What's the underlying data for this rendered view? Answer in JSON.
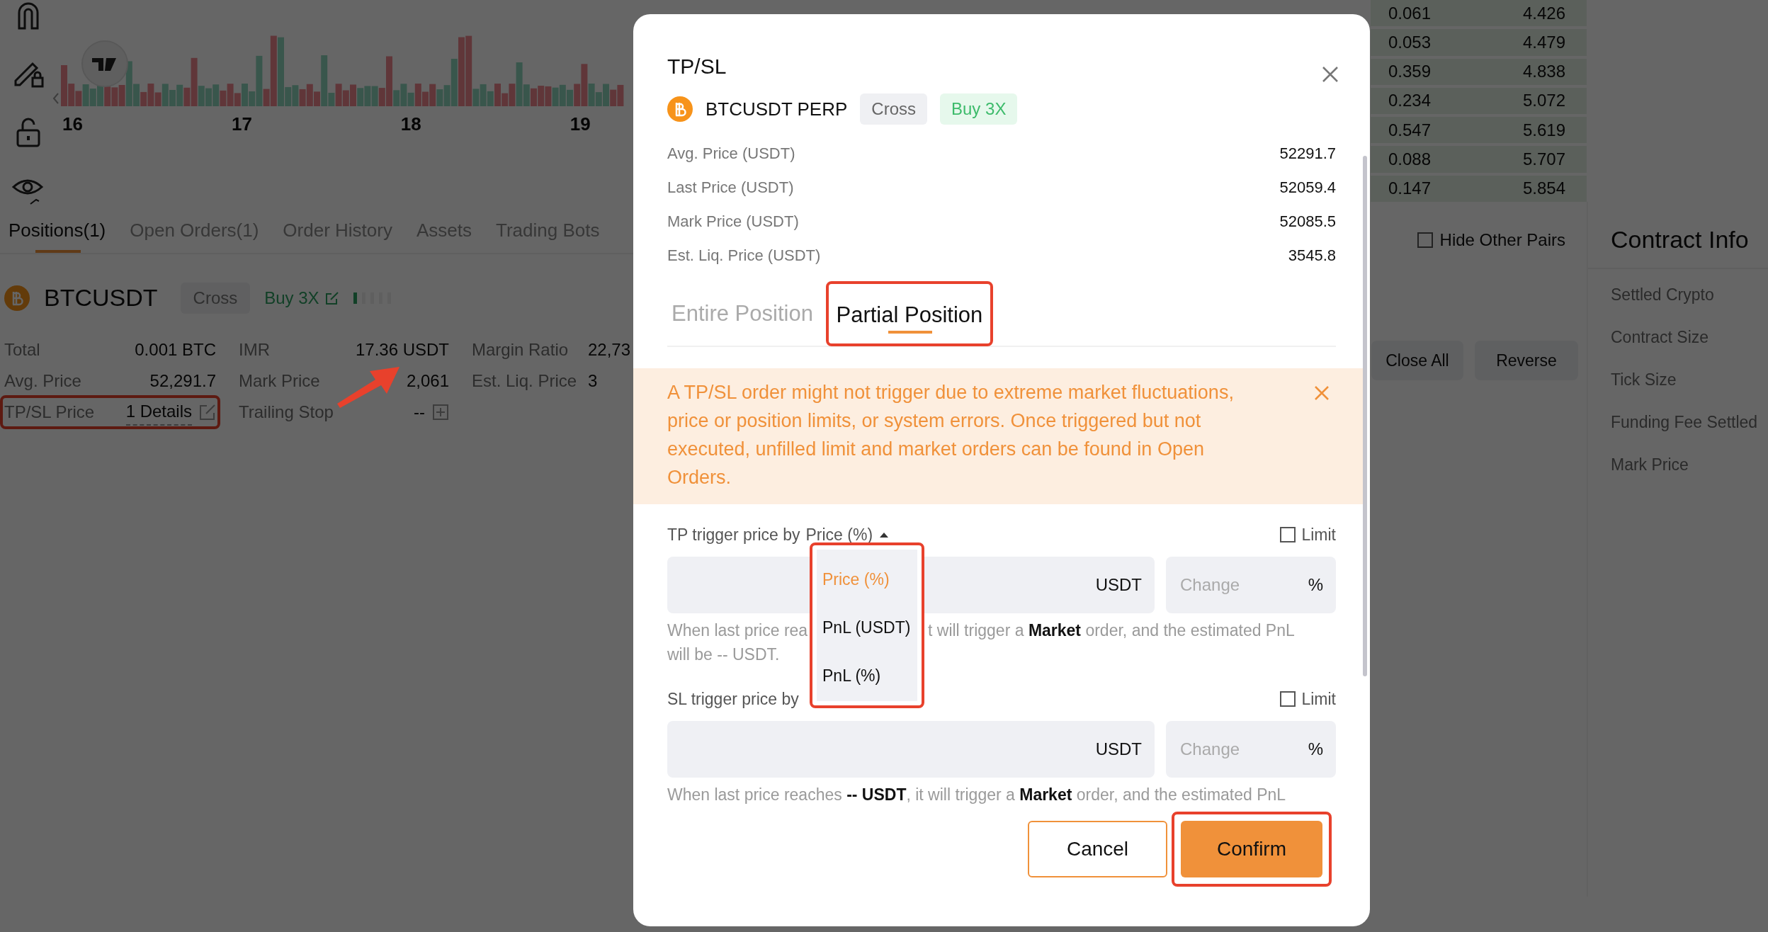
{
  "chart": {
    "date_labels": [
      "16",
      "17",
      "18",
      "19"
    ]
  },
  "order_book": {
    "rows": [
      {
        "amount": "0.061",
        "total": "4.426"
      },
      {
        "amount": "0.053",
        "total": "4.479"
      },
      {
        "amount": "0.359",
        "total": "4.838"
      },
      {
        "amount": "0.234",
        "total": "5.072"
      },
      {
        "amount": "0.547",
        "total": "5.619"
      },
      {
        "amount": "0.088",
        "total": "5.707"
      },
      {
        "amount": "0.147",
        "total": "5.854"
      }
    ]
  },
  "position_tabs": [
    {
      "label": "Positions(1)",
      "selected": true
    },
    {
      "label": "Open Orders(1)",
      "selected": false
    },
    {
      "label": "Order History",
      "selected": false
    },
    {
      "label": "Assets",
      "selected": false
    },
    {
      "label": "Trading Bots",
      "selected": false
    }
  ],
  "hide_other_pairs": {
    "label": "Hide Other Pairs",
    "checked": false
  },
  "position": {
    "symbol": "BTCUSDT",
    "margin_mode": "Cross",
    "side": "Buy 3X",
    "fields": [
      {
        "label": "Total",
        "value": "0.001 BTC",
        "kind": "plain"
      },
      {
        "label": "IMR",
        "value": "17.36 USDT",
        "kind": "plain"
      },
      {
        "label": "Margin Ratio",
        "value": "22,73",
        "kind": "plain"
      },
      {
        "label": "Avg. Price",
        "value": "52,291.7",
        "kind": "plain"
      },
      {
        "label": "Mark Price",
        "value": "2,061",
        "kind": "plain"
      },
      {
        "label": "Est. Liq. Price",
        "value": "3",
        "kind": "plain"
      },
      {
        "label": "TP/SL Price",
        "value": "1 Details",
        "kind": "details"
      },
      {
        "label": "Trailing Stop",
        "value": "--",
        "kind": "add"
      }
    ],
    "actions": [
      "Close All",
      "Reverse"
    ]
  },
  "contract_info": {
    "title": "Contract Info",
    "items": [
      "Settled Crypto",
      "Contract Size",
      "Tick Size",
      "Funding Fee Settled",
      "Mark Price"
    ]
  },
  "dialog": {
    "title": "TP/SL",
    "symbol": "BTCUSDT PERP",
    "margin_mode": "Cross",
    "side": "Buy 3X",
    "info": [
      {
        "label": "Avg. Price (USDT)",
        "value": "52291.7"
      },
      {
        "label": "Last Price (USDT)",
        "value": "52059.4"
      },
      {
        "label": "Mark Price (USDT)",
        "value": "52085.5"
      },
      {
        "label": "Est. Liq. Price (USDT)",
        "value": "3545.8"
      }
    ],
    "tabs": [
      {
        "label": "Entire Position",
        "selected": false
      },
      {
        "label": "Partial Position",
        "selected": true
      }
    ],
    "alert": "A TP/SL order might not trigger due to extreme market fluctuations, price or position limits, or system errors. Once triggered but not executed, unfilled limit and market orders can be found in Open Orders.",
    "tp": {
      "label": "TP trigger price by",
      "trigger_type": "Price (%)",
      "expanded": true,
      "limit": {
        "label": "Limit",
        "checked": false
      },
      "price_unit": "USDT",
      "change_placeholder": "Change",
      "change_unit": "%",
      "hint_left": "When last price rea",
      "hint_right": "t will trigger a **Market** order, and the estimated PnL",
      "hint_line2": "will be -- USDT."
    },
    "trigger_menu": [
      {
        "label": "Price (%)",
        "selected": true
      },
      {
        "label": "PnL (USDT)",
        "selected": false
      },
      {
        "label": "PnL (%)",
        "selected": false
      }
    ],
    "sl": {
      "label": "SL trigger price by",
      "limit": {
        "label": "Limit",
        "checked": false
      },
      "price_unit": "USDT",
      "change_placeholder": "Change",
      "change_unit": "%",
      "hint": "When last price reaches **-- USDT**, it will trigger a **Market** order, and the estimated PnL"
    },
    "buttons": [
      {
        "label": "Cancel",
        "kind": "secondary"
      },
      {
        "label": "Confirm",
        "kind": "primary"
      }
    ]
  }
}
